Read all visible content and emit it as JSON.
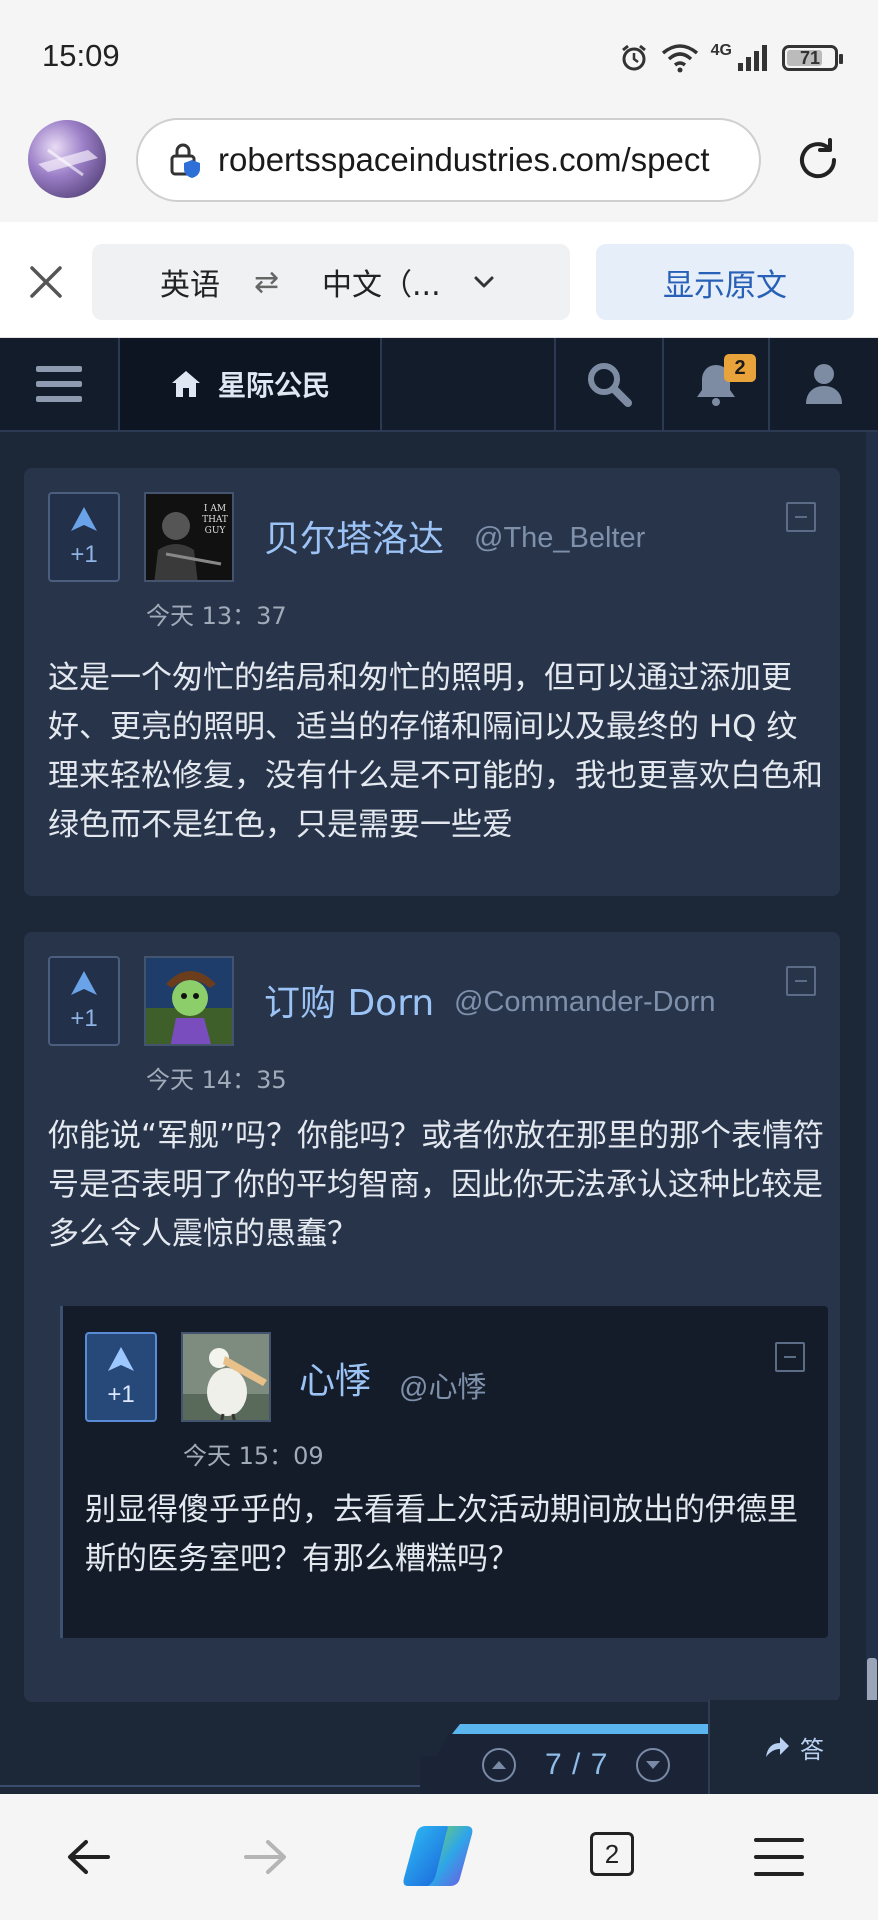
{
  "status_bar": {
    "time": "15:09",
    "network": "4G",
    "battery": "71"
  },
  "browser": {
    "url": "robertsspaceindustries.com/spect",
    "tabs_count": "2"
  },
  "translate_bar": {
    "from_lang": "英语",
    "swap_symbol": "⇄",
    "to_lang": "中文（...",
    "show_original_label": "显示原文"
  },
  "site_nav": {
    "home_label": "星际公民",
    "notification_count": "2"
  },
  "comments": [
    {
      "vote_label": "+1",
      "display_name": "贝尔塔洛达",
      "handle": "@The_Belter",
      "timestamp": "今天 13：37",
      "body": "这是一个匆忙的结局和匆忙的照明，但可以通过添加更好、更亮的照明、适当的存储和隔间以及最终的 HQ 纹理来轻松修复，没有什么是不可能的，我也更喜欢白色和绿色而不是红色，只是需要一些爱",
      "avatar_text": "I AM THAT GUY"
    },
    {
      "vote_label": "+1",
      "display_name": "订购 Dorn",
      "handle": "@Commander-Dorn",
      "timestamp": "今天 14：35",
      "body": "你能说“军舰”吗？你能吗？或者你放在那里的那个表情符号是否表明了你的平均智商，因此你无法承认这种比较是多么令人震惊的愚蠢？"
    },
    {
      "vote_label": "+1",
      "display_name": "心悸",
      "handle": "@心悸",
      "timestamp": "今天 15：09",
      "body": "别显得傻乎乎的，去看看上次活动期间放出的伊德里斯的医务室吧？有那么糟糕吗？"
    }
  ],
  "pager": {
    "text": "7 / 7",
    "reply_label": "答"
  },
  "colors": {
    "site_bg": "#1c2738",
    "card_bg": "#28344a",
    "accent": "#5bb6f0",
    "username": "#9cc3f5",
    "badge": "#e8a33a"
  }
}
